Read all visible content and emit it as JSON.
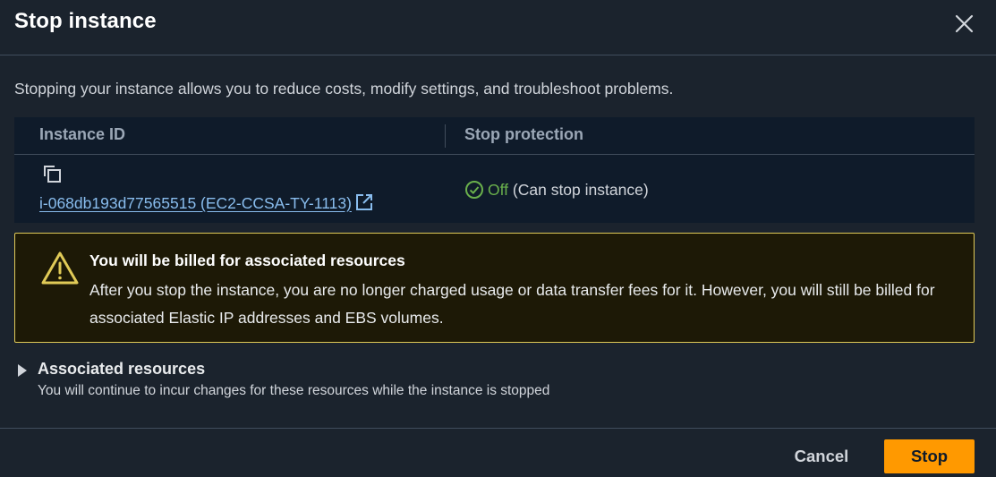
{
  "modal": {
    "title": "Stop instance",
    "close_icon": "close-icon"
  },
  "description": "Stopping your instance allows you to reduce costs, modify settings, and troubleshoot problems.",
  "table": {
    "headers": [
      "Instance ID",
      "Stop protection"
    ],
    "rows": [
      {
        "instance_id": "i-068db193d77565515 (EC2-CCSA-TY-1113)",
        "protection_status": "Off",
        "protection_note": "(Can stop instance)"
      }
    ]
  },
  "alert": {
    "title": "You will be billed for associated resources",
    "body": "After you stop the instance, you are no longer charged usage or data transfer fees for it. However, you will still be billed for associated Elastic IP addresses and EBS volumes.",
    "icon": "warning-icon"
  },
  "expander": {
    "title": "Associated resources",
    "subtitle": "You will continue to incur changes for these resources while the instance is stopped"
  },
  "footer": {
    "cancel_label": "Cancel",
    "stop_label": "Stop"
  },
  "colors": {
    "background": "#1b232d",
    "table_bg": "#0f1b2a",
    "link": "#89bdee",
    "success": "#6ab04c",
    "warning_border": "#e0ca57",
    "primary_button": "#ff9900"
  }
}
